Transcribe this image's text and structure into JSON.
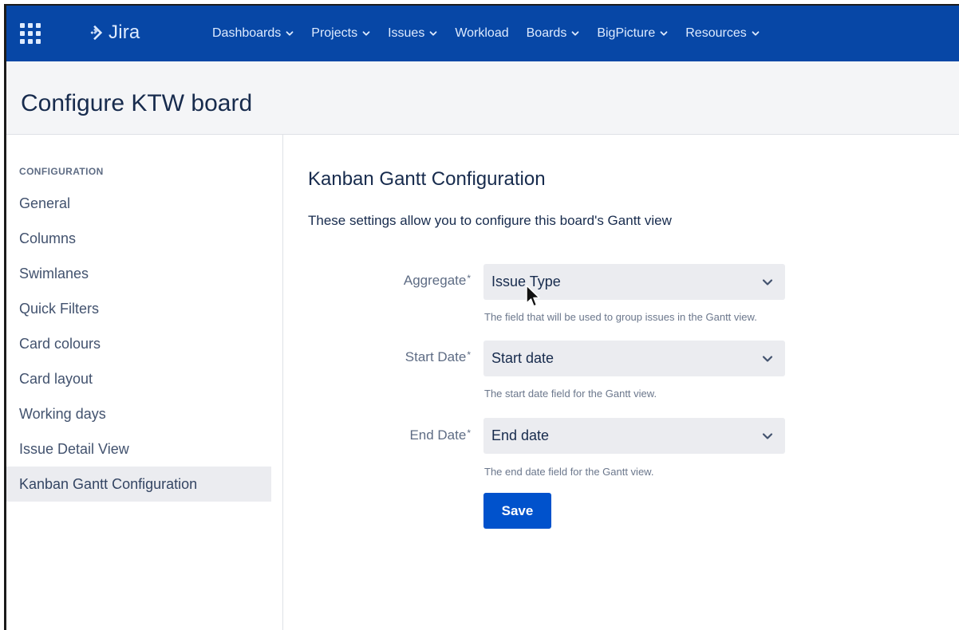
{
  "topnav": {
    "logo_text": "Jira",
    "items": [
      {
        "label": "Dashboards",
        "has_dropdown": true
      },
      {
        "label": "Projects",
        "has_dropdown": true
      },
      {
        "label": "Issues",
        "has_dropdown": true
      },
      {
        "label": "Workload",
        "has_dropdown": false
      },
      {
        "label": "Boards",
        "has_dropdown": true
      },
      {
        "label": "BigPicture",
        "has_dropdown": true
      },
      {
        "label": "Resources",
        "has_dropdown": true
      }
    ]
  },
  "header": {
    "title": "Configure KTW board"
  },
  "sidebar": {
    "heading": "CONFIGURATION",
    "items": [
      {
        "label": "General"
      },
      {
        "label": "Columns"
      },
      {
        "label": "Swimlanes"
      },
      {
        "label": "Quick Filters"
      },
      {
        "label": "Card colours"
      },
      {
        "label": "Card layout"
      },
      {
        "label": "Working days"
      },
      {
        "label": "Issue Detail View"
      },
      {
        "label": "Kanban Gantt Configuration",
        "active": true
      }
    ]
  },
  "main": {
    "title": "Kanban Gantt Configuration",
    "description": "These settings allow you to configure this board's Gantt view",
    "fields": [
      {
        "label": "Aggregate",
        "required_mark": "*",
        "value": "Issue Type",
        "help": "The field that will be used to group issues in the Gantt view."
      },
      {
        "label": "Start Date",
        "required_mark": "*",
        "value": "Start date",
        "help": "The start date field for the Gantt view."
      },
      {
        "label": "End Date",
        "required_mark": "*",
        "value": "End date",
        "help": "The end date field for the Gantt view."
      }
    ],
    "save_label": "Save"
  },
  "colors": {
    "nav_bg": "#0747a6",
    "nav_text": "#deebff",
    "header_bg": "#f4f5f7",
    "primary": "#0052cc",
    "select_bg": "#ebecf0",
    "active_item_bg": "#ebecf0"
  },
  "icons": {
    "app_switcher": "grid-icon",
    "logo": "jira-logo-icon",
    "dropdown": "chevron-down-icon",
    "cursor": "mouse-pointer-icon"
  }
}
